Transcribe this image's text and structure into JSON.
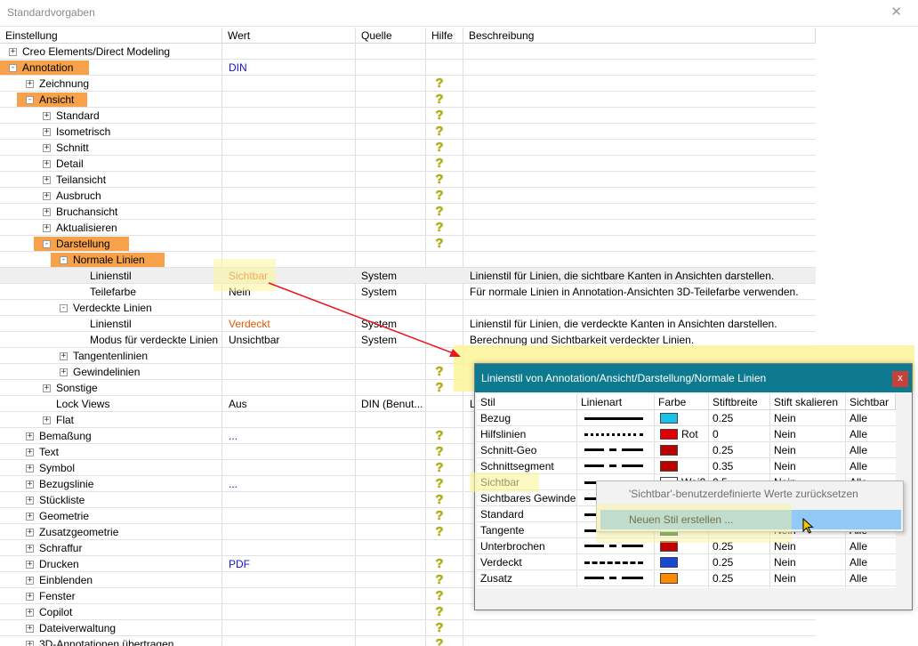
{
  "window": {
    "title": "Standardvorgaben",
    "close_label": "✕"
  },
  "columns": [
    "Einstellung",
    "Wert",
    "Quelle",
    "Hilfe",
    "Beschreibung"
  ],
  "rows": [
    {
      "label": "Creo Elements/Direct Modeling",
      "level": 0,
      "exp": "+",
      "wert": "",
      "quelle": "",
      "help": false,
      "desc": ""
    },
    {
      "label": "Annotation",
      "level": 0,
      "exp": "-",
      "wert": "DIN",
      "wert_color": "blue",
      "quelle": "",
      "help": false,
      "desc": "",
      "hl": true
    },
    {
      "label": "Zeichnung",
      "level": 1,
      "exp": "+",
      "wert": "",
      "quelle": "",
      "help": true,
      "desc": ""
    },
    {
      "label": "Ansicht",
      "level": 1,
      "exp": "-",
      "wert": "",
      "quelle": "",
      "help": true,
      "desc": "",
      "hl": true
    },
    {
      "label": "Standard",
      "level": 2,
      "exp": "+",
      "wert": "",
      "quelle": "",
      "help": true,
      "desc": ""
    },
    {
      "label": "Isometrisch",
      "level": 2,
      "exp": "+",
      "wert": "",
      "quelle": "",
      "help": true,
      "desc": ""
    },
    {
      "label": "Schnitt",
      "level": 2,
      "exp": "+",
      "wert": "",
      "quelle": "",
      "help": true,
      "desc": ""
    },
    {
      "label": "Detail",
      "level": 2,
      "exp": "+",
      "wert": "",
      "quelle": "",
      "help": true,
      "desc": ""
    },
    {
      "label": "Teilansicht",
      "level": 2,
      "exp": "+",
      "wert": "",
      "quelle": "",
      "help": true,
      "desc": ""
    },
    {
      "label": "Ausbruch",
      "level": 2,
      "exp": "+",
      "wert": "",
      "quelle": "",
      "help": true,
      "desc": ""
    },
    {
      "label": "Bruchansicht",
      "level": 2,
      "exp": "+",
      "wert": "",
      "quelle": "",
      "help": true,
      "desc": ""
    },
    {
      "label": "Aktualisieren",
      "level": 2,
      "exp": "+",
      "wert": "",
      "quelle": "",
      "help": true,
      "desc": ""
    },
    {
      "label": "Darstellung",
      "level": 2,
      "exp": "-",
      "wert": "",
      "quelle": "",
      "help": true,
      "desc": "",
      "hl": true
    },
    {
      "label": "Normale Linien",
      "level": 3,
      "exp": "-",
      "wert": "",
      "quelle": "",
      "help": false,
      "desc": "",
      "hl": true
    },
    {
      "label": "Linienstil",
      "level": 4,
      "exp": "",
      "wert": "Sichtbar",
      "wert_color": "orange",
      "quelle": "System",
      "help": false,
      "desc": "Linienstil für Linien, die sichtbare Kanten in Ansichten darstellen.",
      "sel": true
    },
    {
      "label": "Teilefarbe",
      "level": 4,
      "exp": "",
      "wert": "Nein",
      "quelle": "System",
      "help": false,
      "desc": "Für normale Linien in Annotation-Ansichten 3D-Teilefarbe verwenden."
    },
    {
      "label": "Verdeckte Linien",
      "level": 3,
      "exp": "-",
      "wert": "",
      "quelle": "",
      "help": false,
      "desc": ""
    },
    {
      "label": "Linienstil",
      "level": 4,
      "exp": "",
      "wert": "Verdeckt",
      "wert_color": "orange",
      "quelle": "System",
      "help": false,
      "desc": "Linienstil für Linien, die verdeckte Kanten in Ansichten darstellen."
    },
    {
      "label": "Modus für verdeckte Linien",
      "level": 4,
      "exp": "",
      "wert": "Unsichtbar",
      "quelle": "System",
      "help": false,
      "desc": "Berechnung und Sichtbarkeit verdeckter Linien."
    },
    {
      "label": "Tangentenlinien",
      "level": 3,
      "exp": "+",
      "wert": "",
      "quelle": "",
      "help": false,
      "desc": ""
    },
    {
      "label": "Gewindelinien",
      "level": 3,
      "exp": "+",
      "wert": "",
      "quelle": "",
      "help": true,
      "desc": ""
    },
    {
      "label": "Sonstige",
      "level": 2,
      "exp": "+",
      "wert": "",
      "quelle": "",
      "help": true,
      "desc": ""
    },
    {
      "label": "Lock Views",
      "level": 2,
      "exp": "",
      "wert": "Aus",
      "quelle": "DIN (Benut...",
      "help": false,
      "desc": "L"
    },
    {
      "label": "Flat",
      "level": 2,
      "exp": "+",
      "wert": "",
      "quelle": "",
      "help": false,
      "desc": ""
    },
    {
      "label": "Bemaßung",
      "level": 1,
      "exp": "+",
      "wert": "...",
      "wert_color": "blue",
      "quelle": "",
      "help": true,
      "desc": ""
    },
    {
      "label": "Text",
      "level": 1,
      "exp": "+",
      "wert": "",
      "quelle": "",
      "help": true,
      "desc": ""
    },
    {
      "label": "Symbol",
      "level": 1,
      "exp": "+",
      "wert": "",
      "quelle": "",
      "help": true,
      "desc": ""
    },
    {
      "label": "Bezugslinie",
      "level": 1,
      "exp": "+",
      "wert": "...",
      "wert_color": "blue",
      "quelle": "",
      "help": true,
      "desc": ""
    },
    {
      "label": "Stückliste",
      "level": 1,
      "exp": "+",
      "wert": "",
      "quelle": "",
      "help": true,
      "desc": ""
    },
    {
      "label": "Geometrie",
      "level": 1,
      "exp": "+",
      "wert": "",
      "quelle": "",
      "help": true,
      "desc": ""
    },
    {
      "label": "Zusatzgeometrie",
      "level": 1,
      "exp": "+",
      "wert": "",
      "quelle": "",
      "help": true,
      "desc": ""
    },
    {
      "label": "Schraffur",
      "level": 1,
      "exp": "+",
      "wert": "",
      "quelle": "",
      "help": false,
      "desc": ""
    },
    {
      "label": "Drucken",
      "level": 1,
      "exp": "+",
      "wert": "PDF",
      "wert_color": "blue",
      "quelle": "",
      "help": true,
      "desc": ""
    },
    {
      "label": "Einblenden",
      "level": 1,
      "exp": "+",
      "wert": "",
      "quelle": "",
      "help": true,
      "desc": ""
    },
    {
      "label": "Fenster",
      "level": 1,
      "exp": "+",
      "wert": "",
      "quelle": "",
      "help": true,
      "desc": ""
    },
    {
      "label": "Copilot",
      "level": 1,
      "exp": "+",
      "wert": "",
      "quelle": "",
      "help": true,
      "desc": ""
    },
    {
      "label": "Dateiverwaltung",
      "level": 1,
      "exp": "+",
      "wert": "",
      "quelle": "",
      "help": true,
      "desc": ""
    },
    {
      "label": "3D-Annotationen übertragen",
      "level": 1,
      "exp": "+",
      "wert": "",
      "quelle": "",
      "help": true,
      "desc": ""
    }
  ],
  "dialog": {
    "title": "Linienstil von Annotation/Ansicht/Darstellung/Normale Linien",
    "close_label": "x",
    "columns": [
      "Stil",
      "Linienart",
      "Farbe",
      "Stiftbreite",
      "Stift skalieren",
      "Sichtbar"
    ],
    "rows": [
      {
        "stil": "Bezug",
        "linie": "solid",
        "farbe": "#19c0e8",
        "farbe_label": "",
        "breite": "0.25",
        "skal": "Nein",
        "sicht": "Alle"
      },
      {
        "stil": "Hilfslinien",
        "linie": "dotted",
        "farbe": "#e00000",
        "farbe_label": "Rot",
        "breite": "0",
        "skal": "Nein",
        "sicht": "Alle"
      },
      {
        "stil": "Schnitt-Geo",
        "linie": "dashdot",
        "farbe": "#c00000",
        "farbe_label": "",
        "breite": "0.25",
        "skal": "Nein",
        "sicht": "Alle"
      },
      {
        "stil": "Schnittsegment",
        "linie": "dashdot",
        "farbe": "#c00000",
        "farbe_label": "",
        "breite": "0.35",
        "skal": "Nein",
        "sicht": "Alle"
      },
      {
        "stil": "Sichtbar",
        "linie": "solid",
        "farbe": "#ffffff",
        "farbe_label": "Weiß",
        "breite": "0.5",
        "skal": "Nein",
        "sicht": "Alle"
      },
      {
        "stil": "Sichtbares Gewinde",
        "linie": "solid",
        "farbe": "#ffffff",
        "farbe_label": "",
        "breite": "",
        "skal": "",
        "sicht": ""
      },
      {
        "stil": "Standard",
        "linie": "solid",
        "farbe": "#ffffff",
        "farbe_label": "",
        "breite": "",
        "skal": "",
        "sicht": ""
      },
      {
        "stil": "Tangente",
        "linie": "solid",
        "farbe": "#1a8c3a",
        "farbe_label": "",
        "breite": "",
        "skal": "Nein",
        "sicht": "Alle"
      },
      {
        "stil": "Unterbrochen",
        "linie": "dashdot",
        "farbe": "#c00000",
        "farbe_label": "",
        "breite": "0.25",
        "skal": "Nein",
        "sicht": "Alle"
      },
      {
        "stil": "Verdeckt",
        "linie": "dashed",
        "farbe": "#1448d6",
        "farbe_label": "",
        "breite": "0.25",
        "skal": "Nein",
        "sicht": "Alle"
      },
      {
        "stil": "Zusatz",
        "linie": "dashdot",
        "farbe": "#ff8a00",
        "farbe_label": "",
        "breite": "0.25",
        "skal": "Nein",
        "sicht": "Alle"
      }
    ]
  },
  "context_menu": {
    "items": [
      "'Sichtbar'-benutzerdefinierte Werte zurücksetzen",
      "Neuen Stil erstellen ..."
    ]
  }
}
